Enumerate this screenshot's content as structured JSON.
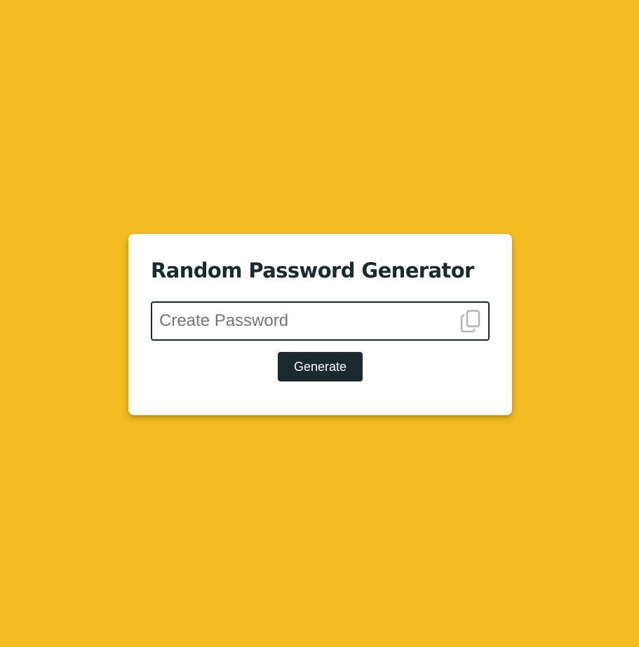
{
  "title": "Random Password Generator",
  "password_input": {
    "value": "",
    "placeholder": "Create Password"
  },
  "copy_icon": "copy-icon",
  "generate_button": {
    "label": "Generate"
  },
  "colors": {
    "background": "#f2bb22",
    "card": "#ffffff",
    "primary": "#1b2a2f",
    "icon": "#b3b3b3"
  }
}
